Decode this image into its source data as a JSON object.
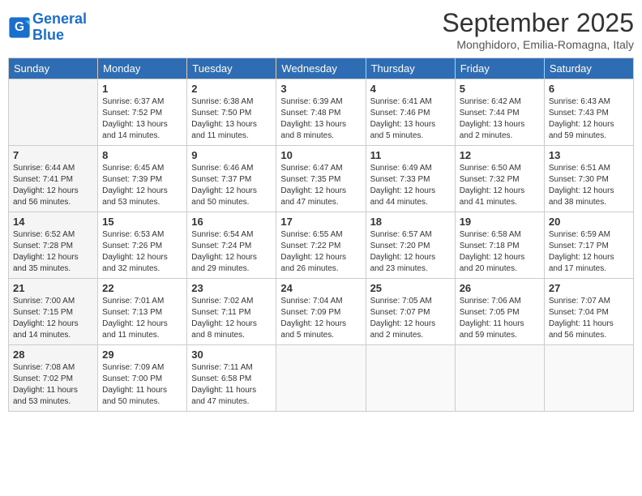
{
  "header": {
    "logo_line1": "General",
    "logo_line2": "Blue",
    "month_title": "September 2025",
    "location": "Monghidoro, Emilia-Romagna, Italy"
  },
  "days_of_week": [
    "Sunday",
    "Monday",
    "Tuesday",
    "Wednesday",
    "Thursday",
    "Friday",
    "Saturday"
  ],
  "weeks": [
    [
      {
        "num": "",
        "lines": []
      },
      {
        "num": "1",
        "lines": [
          "Sunrise: 6:37 AM",
          "Sunset: 7:52 PM",
          "Daylight: 13 hours",
          "and 14 minutes."
        ]
      },
      {
        "num": "2",
        "lines": [
          "Sunrise: 6:38 AM",
          "Sunset: 7:50 PM",
          "Daylight: 13 hours",
          "and 11 minutes."
        ]
      },
      {
        "num": "3",
        "lines": [
          "Sunrise: 6:39 AM",
          "Sunset: 7:48 PM",
          "Daylight: 13 hours",
          "and 8 minutes."
        ]
      },
      {
        "num": "4",
        "lines": [
          "Sunrise: 6:41 AM",
          "Sunset: 7:46 PM",
          "Daylight: 13 hours",
          "and 5 minutes."
        ]
      },
      {
        "num": "5",
        "lines": [
          "Sunrise: 6:42 AM",
          "Sunset: 7:44 PM",
          "Daylight: 13 hours",
          "and 2 minutes."
        ]
      },
      {
        "num": "6",
        "lines": [
          "Sunrise: 6:43 AM",
          "Sunset: 7:43 PM",
          "Daylight: 12 hours",
          "and 59 minutes."
        ]
      }
    ],
    [
      {
        "num": "7",
        "lines": [
          "Sunrise: 6:44 AM",
          "Sunset: 7:41 PM",
          "Daylight: 12 hours",
          "and 56 minutes."
        ]
      },
      {
        "num": "8",
        "lines": [
          "Sunrise: 6:45 AM",
          "Sunset: 7:39 PM",
          "Daylight: 12 hours",
          "and 53 minutes."
        ]
      },
      {
        "num": "9",
        "lines": [
          "Sunrise: 6:46 AM",
          "Sunset: 7:37 PM",
          "Daylight: 12 hours",
          "and 50 minutes."
        ]
      },
      {
        "num": "10",
        "lines": [
          "Sunrise: 6:47 AM",
          "Sunset: 7:35 PM",
          "Daylight: 12 hours",
          "and 47 minutes."
        ]
      },
      {
        "num": "11",
        "lines": [
          "Sunrise: 6:49 AM",
          "Sunset: 7:33 PM",
          "Daylight: 12 hours",
          "and 44 minutes."
        ]
      },
      {
        "num": "12",
        "lines": [
          "Sunrise: 6:50 AM",
          "Sunset: 7:32 PM",
          "Daylight: 12 hours",
          "and 41 minutes."
        ]
      },
      {
        "num": "13",
        "lines": [
          "Sunrise: 6:51 AM",
          "Sunset: 7:30 PM",
          "Daylight: 12 hours",
          "and 38 minutes."
        ]
      }
    ],
    [
      {
        "num": "14",
        "lines": [
          "Sunrise: 6:52 AM",
          "Sunset: 7:28 PM",
          "Daylight: 12 hours",
          "and 35 minutes."
        ]
      },
      {
        "num": "15",
        "lines": [
          "Sunrise: 6:53 AM",
          "Sunset: 7:26 PM",
          "Daylight: 12 hours",
          "and 32 minutes."
        ]
      },
      {
        "num": "16",
        "lines": [
          "Sunrise: 6:54 AM",
          "Sunset: 7:24 PM",
          "Daylight: 12 hours",
          "and 29 minutes."
        ]
      },
      {
        "num": "17",
        "lines": [
          "Sunrise: 6:55 AM",
          "Sunset: 7:22 PM",
          "Daylight: 12 hours",
          "and 26 minutes."
        ]
      },
      {
        "num": "18",
        "lines": [
          "Sunrise: 6:57 AM",
          "Sunset: 7:20 PM",
          "Daylight: 12 hours",
          "and 23 minutes."
        ]
      },
      {
        "num": "19",
        "lines": [
          "Sunrise: 6:58 AM",
          "Sunset: 7:18 PM",
          "Daylight: 12 hours",
          "and 20 minutes."
        ]
      },
      {
        "num": "20",
        "lines": [
          "Sunrise: 6:59 AM",
          "Sunset: 7:17 PM",
          "Daylight: 12 hours",
          "and 17 minutes."
        ]
      }
    ],
    [
      {
        "num": "21",
        "lines": [
          "Sunrise: 7:00 AM",
          "Sunset: 7:15 PM",
          "Daylight: 12 hours",
          "and 14 minutes."
        ]
      },
      {
        "num": "22",
        "lines": [
          "Sunrise: 7:01 AM",
          "Sunset: 7:13 PM",
          "Daylight: 12 hours",
          "and 11 minutes."
        ]
      },
      {
        "num": "23",
        "lines": [
          "Sunrise: 7:02 AM",
          "Sunset: 7:11 PM",
          "Daylight: 12 hours",
          "and 8 minutes."
        ]
      },
      {
        "num": "24",
        "lines": [
          "Sunrise: 7:04 AM",
          "Sunset: 7:09 PM",
          "Daylight: 12 hours",
          "and 5 minutes."
        ]
      },
      {
        "num": "25",
        "lines": [
          "Sunrise: 7:05 AM",
          "Sunset: 7:07 PM",
          "Daylight: 12 hours",
          "and 2 minutes."
        ]
      },
      {
        "num": "26",
        "lines": [
          "Sunrise: 7:06 AM",
          "Sunset: 7:05 PM",
          "Daylight: 11 hours",
          "and 59 minutes."
        ]
      },
      {
        "num": "27",
        "lines": [
          "Sunrise: 7:07 AM",
          "Sunset: 7:04 PM",
          "Daylight: 11 hours",
          "and 56 minutes."
        ]
      }
    ],
    [
      {
        "num": "28",
        "lines": [
          "Sunrise: 7:08 AM",
          "Sunset: 7:02 PM",
          "Daylight: 11 hours",
          "and 53 minutes."
        ]
      },
      {
        "num": "29",
        "lines": [
          "Sunrise: 7:09 AM",
          "Sunset: 7:00 PM",
          "Daylight: 11 hours",
          "and 50 minutes."
        ]
      },
      {
        "num": "30",
        "lines": [
          "Sunrise: 7:11 AM",
          "Sunset: 6:58 PM",
          "Daylight: 11 hours",
          "and 47 minutes."
        ]
      },
      {
        "num": "",
        "lines": []
      },
      {
        "num": "",
        "lines": []
      },
      {
        "num": "",
        "lines": []
      },
      {
        "num": "",
        "lines": []
      }
    ]
  ]
}
